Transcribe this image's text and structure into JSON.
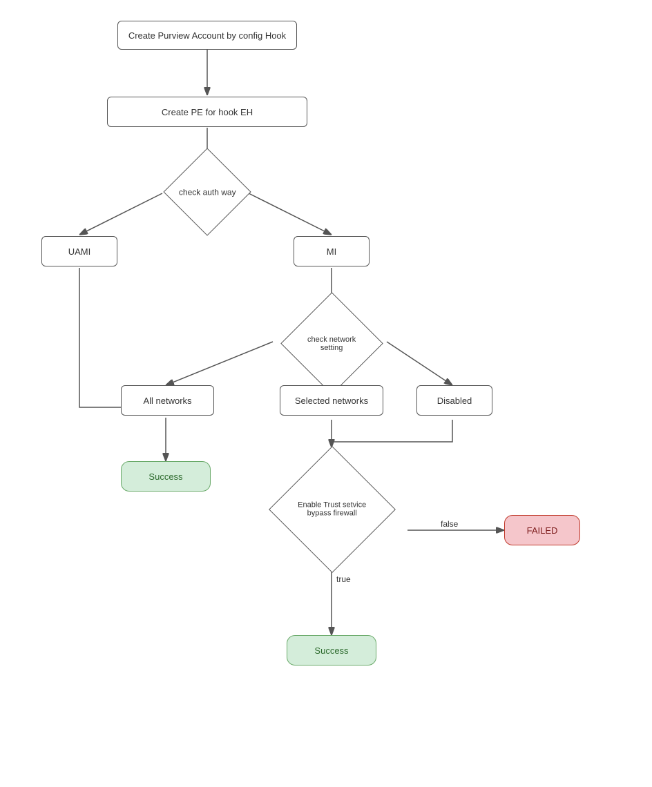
{
  "nodes": {
    "create_purview": "Create Purview Account by config Hook",
    "create_pe": "Create PE for hook EH",
    "check_auth": "check auth way",
    "uami": "UAMI",
    "mi": "MI",
    "check_network": "check network setting",
    "all_networks": "All networks",
    "selected_networks": "Selected networks",
    "disabled": "Disabled",
    "success1": "Success",
    "enable_trust": "Enable Trust setvice\nbypass firewall",
    "failed": "FAILED",
    "success2": "Success"
  },
  "labels": {
    "false": "false",
    "true": "true"
  }
}
